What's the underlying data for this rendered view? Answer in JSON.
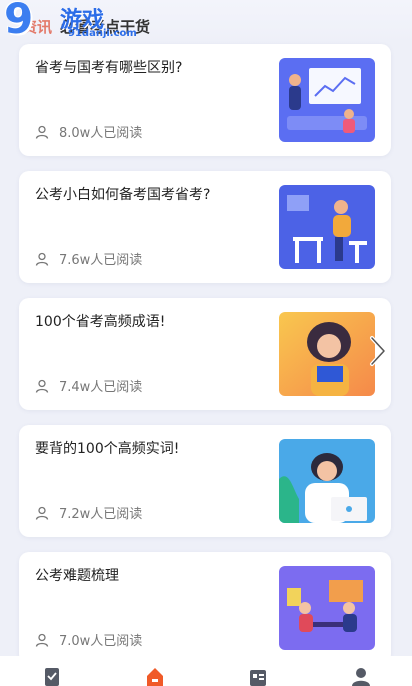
{
  "header": {
    "section_prefix": "资讯",
    "section_title": "必看考点干货",
    "watermark_big": "9",
    "watermark_cn": "游戏",
    "watermark_url": "91danji.com"
  },
  "articles": [
    {
      "title": "省考与国考有哪些区别?",
      "reads": "8.0w人已阅读",
      "thumb": "thumb-presentation"
    },
    {
      "title": "公考小白如何备考国考省考?",
      "reads": "7.6w人已阅读",
      "thumb": "thumb-study-desk"
    },
    {
      "title": "100个省考高频成语!",
      "reads": "7.4w人已阅读",
      "thumb": "thumb-reading-book"
    },
    {
      "title": "要背的100个高频实词!",
      "reads": "7.2w人已阅读",
      "thumb": "thumb-laptop-student"
    },
    {
      "title": "公考难题梳理",
      "reads": "7.0w人已阅读",
      "thumb": "thumb-meeting"
    }
  ],
  "bottom_nav": [
    {
      "icon": "checklist-icon"
    },
    {
      "icon": "home-icon",
      "active": true
    },
    {
      "icon": "news-icon"
    },
    {
      "icon": "profile-icon"
    }
  ],
  "colors": {
    "accent": "#f05a28",
    "nav_icon": "#555a66",
    "card_bg": "#ffffff",
    "page_bg": "#eef0f8"
  }
}
